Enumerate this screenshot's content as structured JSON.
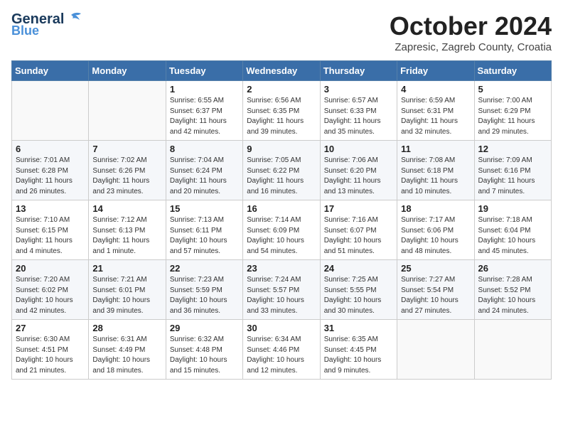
{
  "header": {
    "logo_general": "General",
    "logo_blue": "Blue",
    "month_title": "October 2024",
    "location": "Zapresic, Zagreb County, Croatia"
  },
  "weekdays": [
    "Sunday",
    "Monday",
    "Tuesday",
    "Wednesday",
    "Thursday",
    "Friday",
    "Saturday"
  ],
  "weeks": [
    [
      {
        "day": "",
        "info": ""
      },
      {
        "day": "",
        "info": ""
      },
      {
        "day": "1",
        "info": "Sunrise: 6:55 AM\nSunset: 6:37 PM\nDaylight: 11 hours and 42 minutes."
      },
      {
        "day": "2",
        "info": "Sunrise: 6:56 AM\nSunset: 6:35 PM\nDaylight: 11 hours and 39 minutes."
      },
      {
        "day": "3",
        "info": "Sunrise: 6:57 AM\nSunset: 6:33 PM\nDaylight: 11 hours and 35 minutes."
      },
      {
        "day": "4",
        "info": "Sunrise: 6:59 AM\nSunset: 6:31 PM\nDaylight: 11 hours and 32 minutes."
      },
      {
        "day": "5",
        "info": "Sunrise: 7:00 AM\nSunset: 6:29 PM\nDaylight: 11 hours and 29 minutes."
      }
    ],
    [
      {
        "day": "6",
        "info": "Sunrise: 7:01 AM\nSunset: 6:28 PM\nDaylight: 11 hours and 26 minutes."
      },
      {
        "day": "7",
        "info": "Sunrise: 7:02 AM\nSunset: 6:26 PM\nDaylight: 11 hours and 23 minutes."
      },
      {
        "day": "8",
        "info": "Sunrise: 7:04 AM\nSunset: 6:24 PM\nDaylight: 11 hours and 20 minutes."
      },
      {
        "day": "9",
        "info": "Sunrise: 7:05 AM\nSunset: 6:22 PM\nDaylight: 11 hours and 16 minutes."
      },
      {
        "day": "10",
        "info": "Sunrise: 7:06 AM\nSunset: 6:20 PM\nDaylight: 11 hours and 13 minutes."
      },
      {
        "day": "11",
        "info": "Sunrise: 7:08 AM\nSunset: 6:18 PM\nDaylight: 11 hours and 10 minutes."
      },
      {
        "day": "12",
        "info": "Sunrise: 7:09 AM\nSunset: 6:16 PM\nDaylight: 11 hours and 7 minutes."
      }
    ],
    [
      {
        "day": "13",
        "info": "Sunrise: 7:10 AM\nSunset: 6:15 PM\nDaylight: 11 hours and 4 minutes."
      },
      {
        "day": "14",
        "info": "Sunrise: 7:12 AM\nSunset: 6:13 PM\nDaylight: 11 hours and 1 minute."
      },
      {
        "day": "15",
        "info": "Sunrise: 7:13 AM\nSunset: 6:11 PM\nDaylight: 10 hours and 57 minutes."
      },
      {
        "day": "16",
        "info": "Sunrise: 7:14 AM\nSunset: 6:09 PM\nDaylight: 10 hours and 54 minutes."
      },
      {
        "day": "17",
        "info": "Sunrise: 7:16 AM\nSunset: 6:07 PM\nDaylight: 10 hours and 51 minutes."
      },
      {
        "day": "18",
        "info": "Sunrise: 7:17 AM\nSunset: 6:06 PM\nDaylight: 10 hours and 48 minutes."
      },
      {
        "day": "19",
        "info": "Sunrise: 7:18 AM\nSunset: 6:04 PM\nDaylight: 10 hours and 45 minutes."
      }
    ],
    [
      {
        "day": "20",
        "info": "Sunrise: 7:20 AM\nSunset: 6:02 PM\nDaylight: 10 hours and 42 minutes."
      },
      {
        "day": "21",
        "info": "Sunrise: 7:21 AM\nSunset: 6:01 PM\nDaylight: 10 hours and 39 minutes."
      },
      {
        "day": "22",
        "info": "Sunrise: 7:23 AM\nSunset: 5:59 PM\nDaylight: 10 hours and 36 minutes."
      },
      {
        "day": "23",
        "info": "Sunrise: 7:24 AM\nSunset: 5:57 PM\nDaylight: 10 hours and 33 minutes."
      },
      {
        "day": "24",
        "info": "Sunrise: 7:25 AM\nSunset: 5:55 PM\nDaylight: 10 hours and 30 minutes."
      },
      {
        "day": "25",
        "info": "Sunrise: 7:27 AM\nSunset: 5:54 PM\nDaylight: 10 hours and 27 minutes."
      },
      {
        "day": "26",
        "info": "Sunrise: 7:28 AM\nSunset: 5:52 PM\nDaylight: 10 hours and 24 minutes."
      }
    ],
    [
      {
        "day": "27",
        "info": "Sunrise: 6:30 AM\nSunset: 4:51 PM\nDaylight: 10 hours and 21 minutes."
      },
      {
        "day": "28",
        "info": "Sunrise: 6:31 AM\nSunset: 4:49 PM\nDaylight: 10 hours and 18 minutes."
      },
      {
        "day": "29",
        "info": "Sunrise: 6:32 AM\nSunset: 4:48 PM\nDaylight: 10 hours and 15 minutes."
      },
      {
        "day": "30",
        "info": "Sunrise: 6:34 AM\nSunset: 4:46 PM\nDaylight: 10 hours and 12 minutes."
      },
      {
        "day": "31",
        "info": "Sunrise: 6:35 AM\nSunset: 4:45 PM\nDaylight: 10 hours and 9 minutes."
      },
      {
        "day": "",
        "info": ""
      },
      {
        "day": "",
        "info": ""
      }
    ]
  ]
}
